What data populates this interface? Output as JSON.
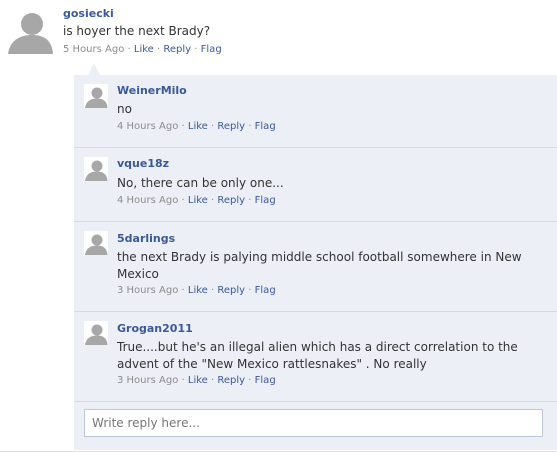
{
  "comment": {
    "author": "gosiecki",
    "text": "is hoyer the next Brady?",
    "time": "5 Hours Ago",
    "actions": {
      "like": "Like",
      "reply": "Reply",
      "flag": "Flag"
    }
  },
  "replies": [
    {
      "author": "WeinerMilo",
      "text": "no",
      "time": "4 Hours Ago",
      "actions": {
        "like": "Like",
        "reply": "Reply",
        "flag": "Flag"
      }
    },
    {
      "author": "vque18z",
      "text": "No, there can be only one...",
      "time": "4 Hours Ago",
      "actions": {
        "like": "Like",
        "reply": "Reply",
        "flag": "Flag"
      }
    },
    {
      "author": "5darlings",
      "text": "the next Brady is palying middle school football somewhere in New Mexico",
      "time": "3 Hours Ago",
      "actions": {
        "like": "Like",
        "reply": "Reply",
        "flag": "Flag"
      }
    },
    {
      "author": "Grogan2011",
      "text": "True....but he's an illegal alien which has a direct correlation to the advent of the \"New Mexico rattlesnakes\" . No really",
      "time": "3 Hours Ago",
      "actions": {
        "like": "Like",
        "reply": "Reply",
        "flag": "Flag"
      }
    }
  ],
  "reply_input": {
    "placeholder": "Write reply here..."
  },
  "separator": "·",
  "icons": {
    "avatar": "default-user-silhouette-icon"
  },
  "colors": {
    "link": "#3b5998",
    "reply_background": "#eceff6",
    "meta": "#8c8c8c"
  }
}
